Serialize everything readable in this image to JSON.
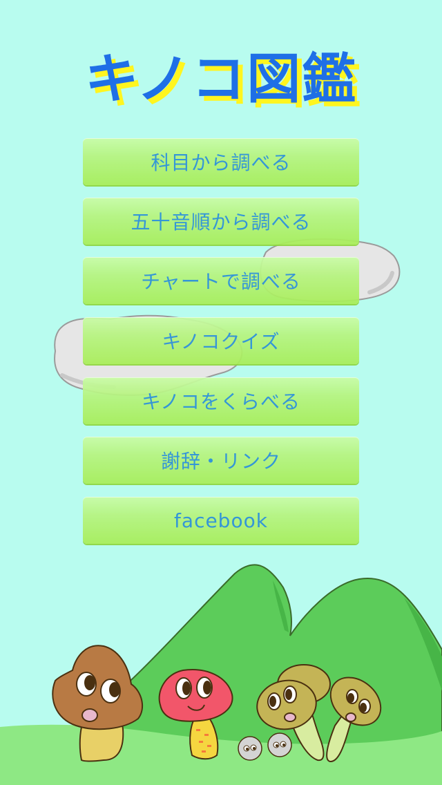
{
  "app": {
    "title": "キノコ図鑑"
  },
  "menu": {
    "items": [
      {
        "id": "by-subject",
        "label": "科目から調べる"
      },
      {
        "id": "by-syllabary",
        "label": "五十音順から調べる"
      },
      {
        "id": "by-chart",
        "label": "チャートで調べる"
      },
      {
        "id": "quiz",
        "label": "キノコクイズ"
      },
      {
        "id": "compare",
        "label": "キノコをくらべる"
      },
      {
        "id": "credits",
        "label": "謝辞・リンク"
      },
      {
        "id": "facebook",
        "label": "facebook"
      }
    ]
  },
  "colors": {
    "background": "#b8fcef",
    "title": "#1f6fe6",
    "title_shadow": "#fff51f",
    "button_top": "#c9fca6",
    "button_bottom": "#a8ee58",
    "button_text": "#2b8fd6",
    "hill": "#5ccc5a",
    "grass": "#8ee884"
  }
}
